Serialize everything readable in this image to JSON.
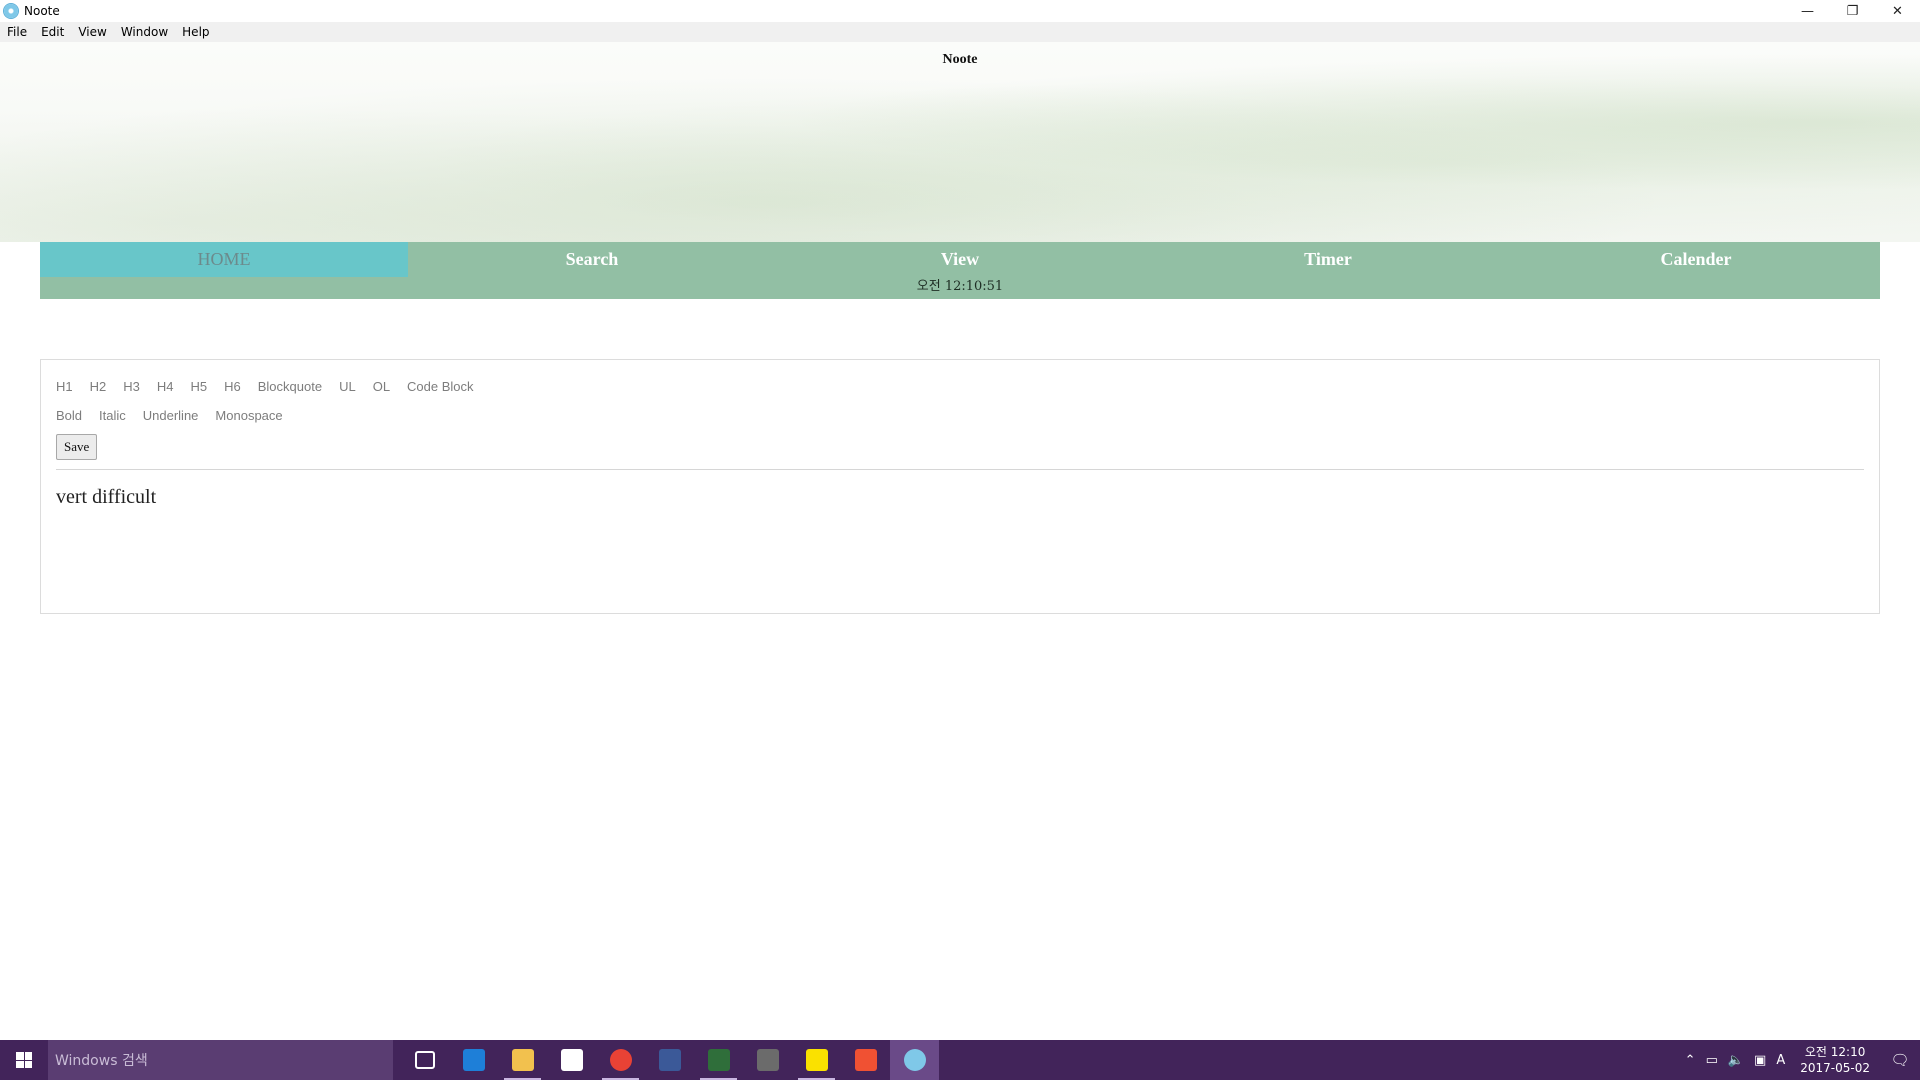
{
  "window": {
    "title": "Noote",
    "controls": {
      "minimize": "—",
      "restore": "❐",
      "close": "✕"
    }
  },
  "menu": [
    "File",
    "Edit",
    "View",
    "Window",
    "Help"
  ],
  "banner": {
    "title": "Noote"
  },
  "nav": {
    "tabs": [
      "HOME",
      "Search",
      "View",
      "Timer",
      "Calender"
    ],
    "active_index": 0,
    "clock": "오전 12:10:51"
  },
  "editor": {
    "format_row1": [
      "H1",
      "H2",
      "H3",
      "H4",
      "H5",
      "H6",
      "Blockquote",
      "UL",
      "OL",
      "Code Block"
    ],
    "format_row2": [
      "Bold",
      "Italic",
      "Underline",
      "Monospace"
    ],
    "save_label": "Save",
    "content": "vert difficult"
  },
  "taskbar": {
    "search_placeholder": "Windows 검색",
    "apps": [
      {
        "icon": "task-view-icon",
        "color": "#42245a"
      },
      {
        "icon": "edge-icon",
        "color": "#1e7fd8"
      },
      {
        "icon": "file-explorer-icon",
        "color": "#f2c14e"
      },
      {
        "icon": "store-icon",
        "color": "#ffffff"
      },
      {
        "icon": "chrome-icon",
        "color": "#e94235"
      },
      {
        "icon": "facebook-icon",
        "color": "#3b5998"
      },
      {
        "icon": "terminal-icon",
        "color": "#2f6e3a"
      },
      {
        "icon": "sublime-icon",
        "color": "#6b6b6b"
      },
      {
        "icon": "kakaotalk-icon",
        "color": "#fae100"
      },
      {
        "icon": "git-icon",
        "color": "#f05133"
      },
      {
        "icon": "noote-app-icon",
        "color": "#7fc8e8"
      }
    ],
    "tray": {
      "time": "오전 12:10",
      "date": "2017-05-02",
      "ime": "A",
      "notifications": "1"
    }
  }
}
